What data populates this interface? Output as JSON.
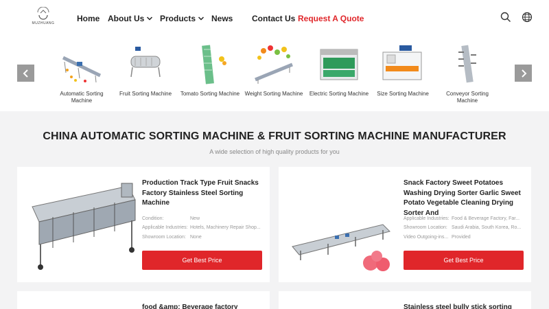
{
  "header": {
    "logo_text": "MUZHUANG",
    "nav": [
      {
        "label": "Home",
        "dropdown": false
      },
      {
        "label": "About Us",
        "dropdown": true
      },
      {
        "label": "Products",
        "dropdown": true
      },
      {
        "label": "News",
        "dropdown": false
      },
      {
        "label": "Contact Us",
        "dropdown": false
      },
      {
        "label": "Request A Quote",
        "dropdown": false
      }
    ],
    "icons": [
      "search-icon",
      "globe-icon"
    ],
    "accent_color": "#e0262a"
  },
  "carousel": {
    "prev_icon": "chevron-left-icon",
    "next_icon": "chevron-right-icon",
    "categories": [
      {
        "label": "Automatic Sorting Machine"
      },
      {
        "label": "Fruit Sorting Machine"
      },
      {
        "label": "Tomato Sorting Machine"
      },
      {
        "label": "Weight Sorting Machine"
      },
      {
        "label": "Electric Sorting Machine"
      },
      {
        "label": "Size Sorting Machine"
      },
      {
        "label": "Conveyor Sorting Machine"
      }
    ]
  },
  "section": {
    "title": "CHINA AUTOMATIC SORTING MACHINE & FRUIT SORTING MACHINE MANUFACTURER",
    "subtitle": "A wide selection of high quality products for you"
  },
  "products": [
    {
      "title": "Production Track Type Fruit Snacks Factory Stainless Steel Sorting Machine",
      "specs": [
        {
          "key": "Condition:",
          "value": "New"
        },
        {
          "key": "Applicable Industries:",
          "value": "Hotels, Machinery Repair Shop..."
        },
        {
          "key": "Showroom Location:",
          "value": "None"
        }
      ],
      "button": "Get Best Price"
    },
    {
      "title": "Snack Factory Sweet Potatoes Washing Drying Sorter Garlic Sweet Potato Vegetable Cleaning Drying Sorter And",
      "specs": [
        {
          "key": "Applicable Industries:",
          "value": "Food & Beverage Factory, Far..."
        },
        {
          "key": "Showroom Location:",
          "value": "Saudi Arabia, South Korea, Ro..."
        },
        {
          "key": "Video Outgoing-ins...",
          "value": "Provided"
        }
      ],
      "button": "Get Best Price"
    },
    {
      "title": "food &amp; Beverage factory automatic",
      "specs": [],
      "button": ""
    },
    {
      "title": "Stainless steel bully stick sorting",
      "specs": [],
      "button": ""
    }
  ]
}
